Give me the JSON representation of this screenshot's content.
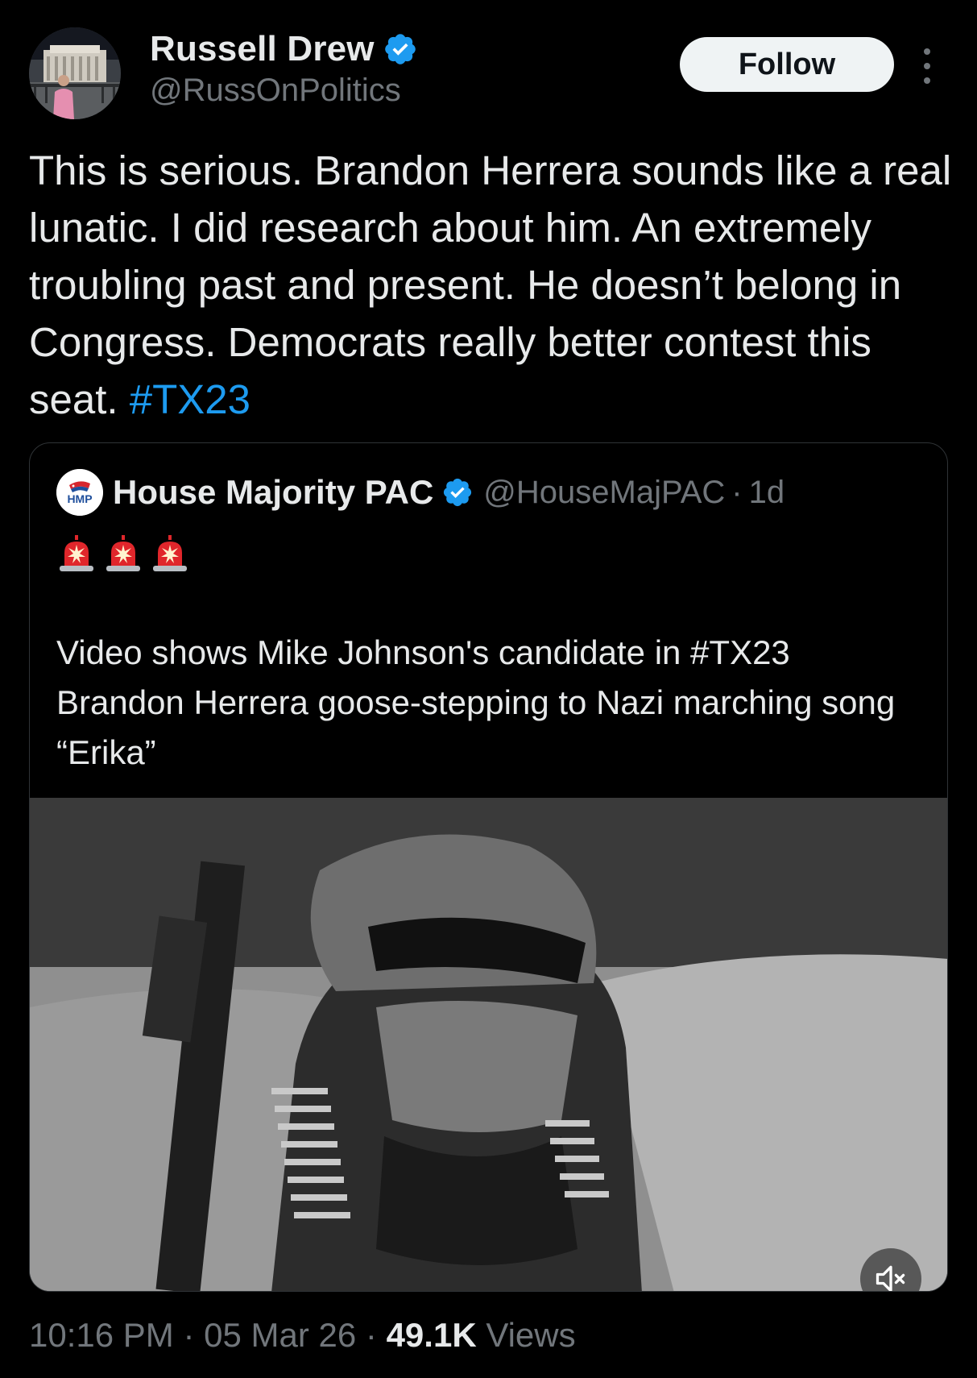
{
  "author": {
    "name": "Russell Drew",
    "handle": "@RussOnPolitics",
    "verified": true
  },
  "actions": {
    "follow_label": "Follow",
    "more_icon": "more-vertical-icon"
  },
  "tweet": {
    "text": "This is serious. Brandon Herrera sounds like a real lunatic. I did research about him. An extremely troubling past and present. He doesn’t belong in Congress. Democrats really better contest this seat.",
    "hashtag": "#TX23"
  },
  "quoted_tweet": {
    "avatar_label": "HMP",
    "name": "House Majority PAC",
    "handle": "@HouseMajPAC",
    "separator": "·",
    "time": "1d",
    "emoji": [
      "🚨",
      "🚨",
      "🚨"
    ],
    "text": "Video shows Mike Johnson's candidate in #TX23 Brandon Herrera goose-stepping to Nazi marching song “Erika”",
    "media_controls": {
      "mute_icon": "speaker-muted-icon"
    }
  },
  "meta": {
    "time": "10:16 PM",
    "separator": "·",
    "date": "05 Mar 26",
    "views_count": "49.1K",
    "views_label": "Views"
  },
  "colors": {
    "background": "#000000",
    "text": "#e7e9ea",
    "muted": "#71767b",
    "accent": "#1d9bf0",
    "border": "#2f3336"
  }
}
